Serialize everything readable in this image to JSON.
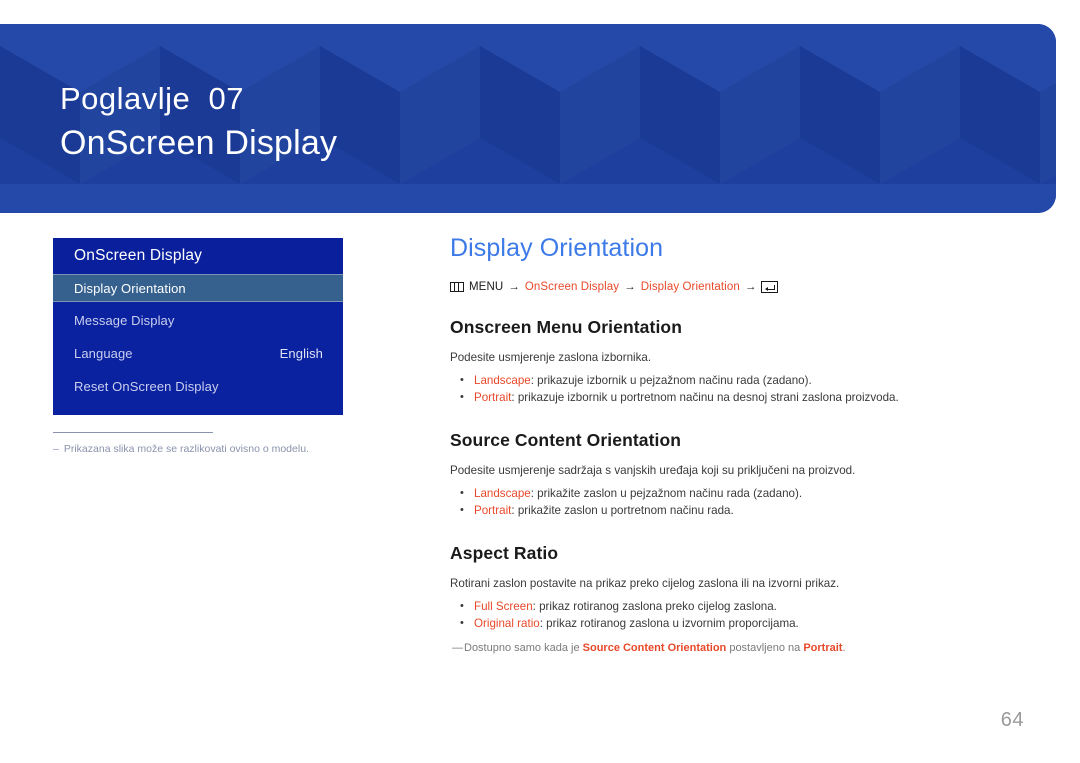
{
  "banner": {
    "chapter_label": "Poglavlje  07",
    "chapter_title": "OnScreen Display",
    "background_color": "#1e3f9e"
  },
  "osd_menu": {
    "title": "OnScreen Display",
    "title_bg": "#0a1f9b",
    "panel_bg": "#0a21a0",
    "highlight_bg": "#36618e",
    "items": [
      {
        "label": "Display Orientation",
        "value": "",
        "selected": true
      },
      {
        "label": "Message Display",
        "value": "",
        "selected": false
      },
      {
        "label": "Language",
        "value": "English",
        "selected": false
      },
      {
        "label": "Reset OnScreen Display",
        "value": "",
        "selected": false
      }
    ],
    "note": {
      "dash": "–",
      "text": "Prikazana slika može se razlikovati ovisno o modelu."
    }
  },
  "content": {
    "page_title": "Display Orientation",
    "title_color": "#3c7ae8",
    "breadcrumb": {
      "menu_icon": "menu-bars-icon",
      "menu_label": "MENU",
      "arrow": "→",
      "crumb1": "OnScreen Display",
      "crumb2": "Display Orientation",
      "enter_icon": "enter-key-icon",
      "accent_color": "#e8492a"
    },
    "sections": [
      {
        "heading": "Onscreen Menu Orientation",
        "intro": "Podesite usmjerenje zaslona izbornika.",
        "bullets": [
          {
            "marker": "•",
            "term": "Landscape",
            "rest": ": prikazuje izbornik u pejzažnom načinu rada (zadano)."
          },
          {
            "marker": "•",
            "term": "Portrait",
            "rest": ": prikazuje izbornik u portretnom načinu na desnoj strani zaslona proizvoda."
          }
        ],
        "footnote": null
      },
      {
        "heading": "Source Content Orientation",
        "intro": "Podesite usmjerenje sadržaja s vanjskih uređaja koji su priključeni na proizvod.",
        "bullets": [
          {
            "marker": "•",
            "term": "Landscape",
            "rest": ": prikažite zaslon u pejzažnom načinu rada (zadano)."
          },
          {
            "marker": "•",
            "term": "Portrait",
            "rest": ": prikažite zaslon u portretnom načinu rada."
          }
        ],
        "footnote": null
      },
      {
        "heading": "Aspect Ratio",
        "intro": "Rotirani zaslon postavite na prikaz preko cijelog zaslona ili na izvorni prikaz.",
        "bullets": [
          {
            "marker": "•",
            "term": "Full Screen",
            "rest": ": prikaz rotiranog zaslona preko cijelog zaslona."
          },
          {
            "marker": "•",
            "term": "Original ratio",
            "rest": ": prikaz rotiranog zaslona u izvornim proporcijama."
          }
        ],
        "footnote": {
          "dash": "—",
          "before": "Dostupno samo kada je ",
          "strong1": "Source Content Orientation",
          "middle": " postavljeno na ",
          "strong2": "Portrait",
          "after": "."
        }
      }
    ]
  },
  "page_number": "64"
}
